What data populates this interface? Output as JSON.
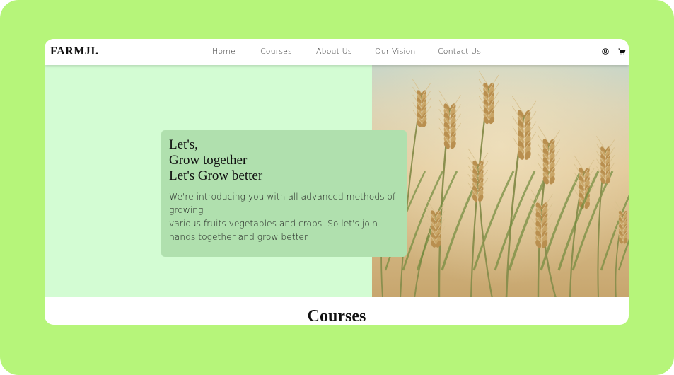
{
  "brand": {
    "logo": "FARMJI."
  },
  "nav": {
    "items": [
      "Home",
      "Courses",
      "About Us",
      "Our Vision",
      "Contact Us"
    ]
  },
  "header_icons": [
    "user-circle-icon",
    "shopping-cart-icon"
  ],
  "hero": {
    "title_lines": [
      "Let's,",
      "Grow together",
      "Let's Grow better"
    ],
    "description_lines": [
      "We're introducing you with all advanced methods of growing",
      "various fruits vegetables and crops. So let's join hands together and grow better"
    ],
    "image_subject": "wheat field"
  },
  "sections": {
    "courses_title": "Courses"
  },
  "colors": {
    "outer_background": "#b6f57a",
    "hero_background": "#d3fcd3",
    "hero_card": "#b0e0ae"
  }
}
